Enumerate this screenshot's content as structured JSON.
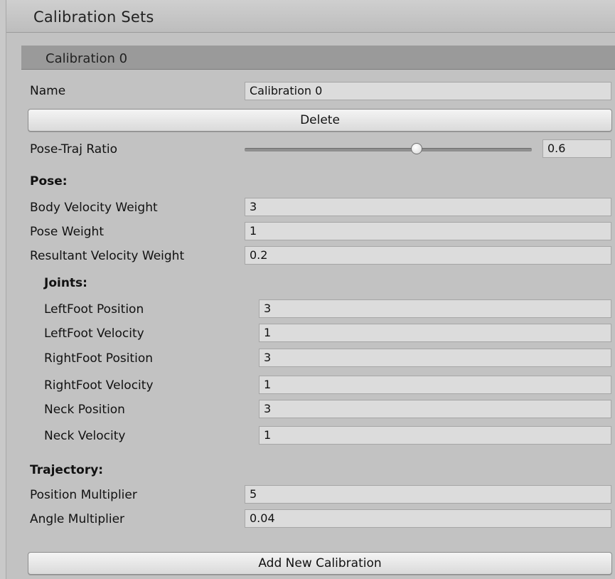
{
  "panel": {
    "title": "Calibration Sets"
  },
  "calibration": {
    "header": "Calibration 0",
    "name_label": "Name",
    "name_value": "Calibration 0",
    "delete_label": "Delete",
    "ratio_label": "Pose-Traj Ratio",
    "ratio_value": "0.6",
    "ratio_fraction": 0.6
  },
  "pose": {
    "heading": "Pose:",
    "fields": [
      {
        "label": "Body Velocity Weight",
        "value": "3"
      },
      {
        "label": "Pose Weight",
        "value": "1"
      },
      {
        "label": "Resultant Velocity Weight",
        "value": "0.2"
      }
    ]
  },
  "joints": {
    "heading": "Joints:",
    "fields": [
      {
        "label": "LeftFoot Position",
        "value": "3"
      },
      {
        "label": "LeftFoot Velocity",
        "value": "1"
      },
      {
        "label": "RightFoot Position",
        "value": "3"
      },
      {
        "label": "RightFoot Velocity",
        "value": "1"
      },
      {
        "label": "Neck Position",
        "value": "3"
      },
      {
        "label": "Neck Velocity",
        "value": "1"
      }
    ]
  },
  "trajectory": {
    "heading": "Trajectory:",
    "fields": [
      {
        "label": "Position Multiplier",
        "value": "5"
      },
      {
        "label": "Angle Multiplier",
        "value": "0.04"
      }
    ]
  },
  "footer": {
    "add_label": "Add New Calibration"
  }
}
